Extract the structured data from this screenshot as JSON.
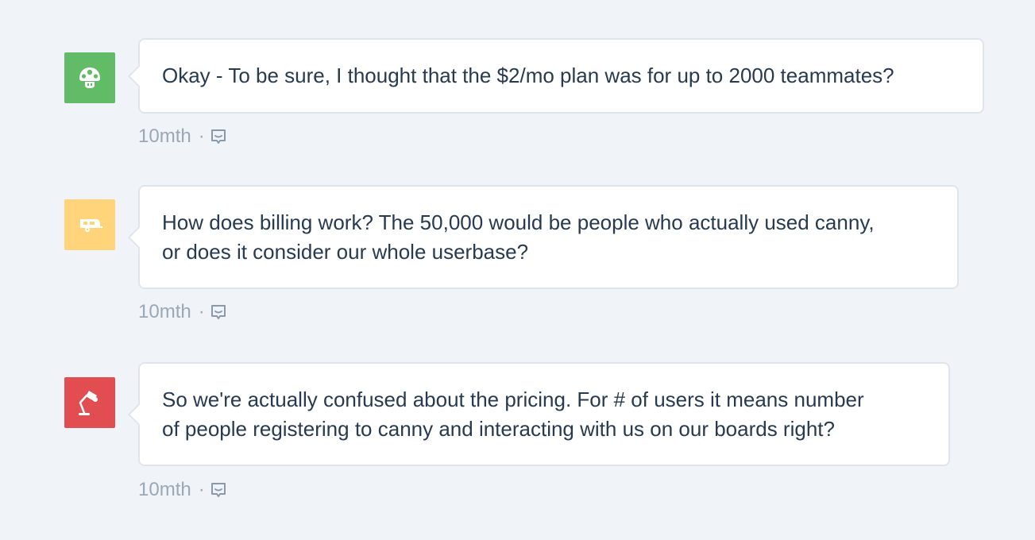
{
  "comments": [
    {
      "avatar_color": "#62bb66",
      "avatar_icon": "mushroom-icon",
      "text": "Okay - To be sure, I thought that the $2/mo plan was for up to 2000 teammates?",
      "time": "10mth",
      "separator": "·",
      "reply_icon": "reply-icon"
    },
    {
      "avatar_color": "#ffd47a",
      "avatar_icon": "camper-trailer-icon",
      "text": "How does billing work? The 50,000 would be people who actually used canny,\nor does it consider our whole userbase?",
      "time": "10mth",
      "separator": "·",
      "reply_icon": "reply-icon"
    },
    {
      "avatar_color": "#e24d52",
      "avatar_icon": "desk-lamp-icon",
      "text": "So we're actually confused about the pricing. For # of users it means number\nof people registering to canny and interacting with us on our boards right?",
      "time": "10mth",
      "separator": "·",
      "reply_icon": "reply-icon"
    }
  ]
}
